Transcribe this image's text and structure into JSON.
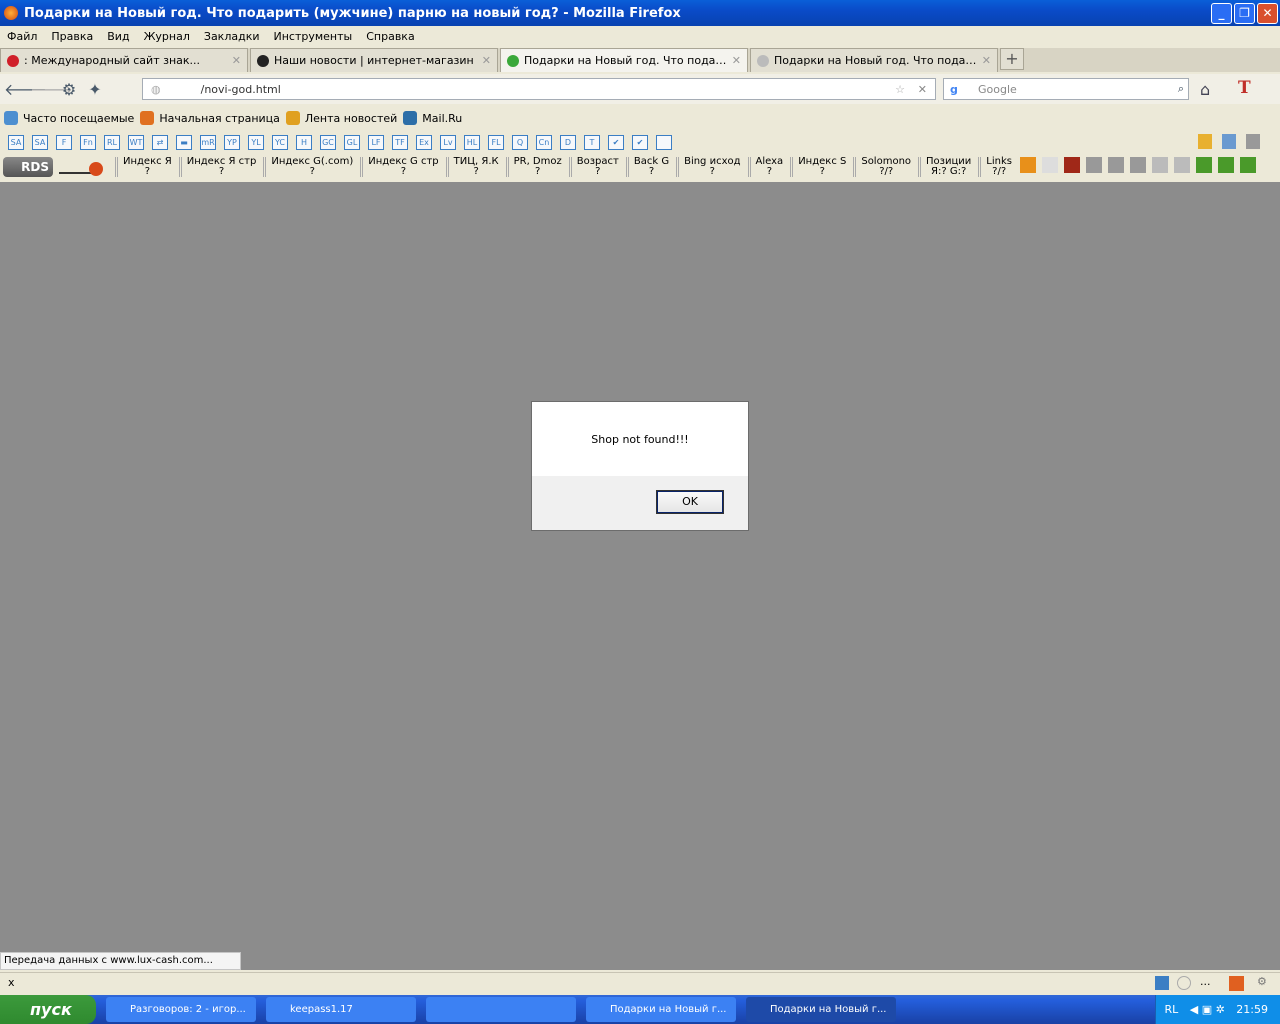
{
  "window": {
    "title": "Подарки на Новый год. Что подарить (мужчине) парню на новый год? - Mozilla Firefox"
  },
  "menu": [
    "Файл",
    "Правка",
    "Вид",
    "Журнал",
    "Закладки",
    "Инструменты",
    "Справка"
  ],
  "tabs": [
    {
      "label": ": Международный сайт знак...",
      "color": "#d0202a",
      "active": false
    },
    {
      "label": "Наши новости | интернет-магазин",
      "color": "#222",
      "active": false
    },
    {
      "label": "Подарки на Новый год. Что подарить ...",
      "color": "#3aa83a",
      "active": true
    },
    {
      "label": "Подарки на Новый год. Что подарить ...",
      "color": "#bbb",
      "active": false
    }
  ],
  "new_tab": "+",
  "address": {
    "value": "/novi-god.html"
  },
  "search": {
    "placeholder": "Google"
  },
  "bookmarks": [
    {
      "label": "Часто посещаемые",
      "color": "#4d8fd0"
    },
    {
      "label": "Начальная страница",
      "color": "#e07020"
    },
    {
      "label": "Лента новостей",
      "color": "#e0a020"
    },
    {
      "label": "Mail.Ru",
      "color": "#2c6ea8"
    }
  ],
  "toolbar1": [
    "SA",
    "SA",
    "F",
    "Fn",
    "RL",
    "WT",
    "⇄",
    "▬",
    "mR",
    "YP",
    "YL",
    "YC",
    "H",
    "GC",
    "GL",
    "LF",
    "TF",
    "Ex",
    "Lv",
    "HL",
    "FL",
    "Q",
    "Cn",
    "D",
    "T",
    "✔",
    "✔",
    ""
  ],
  "toolbar2": {
    "rds": "RDS",
    "metrics": [
      {
        "label": "Индекс Я",
        "value": "?"
      },
      {
        "label": "Индекс Я стр",
        "value": "?"
      },
      {
        "label": "Индекс G(.com)",
        "value": "?"
      },
      {
        "label": "Индекс G стр",
        "value": "?"
      },
      {
        "label": "ТИЦ, Я.К",
        "value": "?"
      },
      {
        "label": "PR, Dmoz",
        "value": "?"
      },
      {
        "label": "Возраст",
        "value": "?"
      },
      {
        "label": "Back G",
        "value": "?"
      },
      {
        "label": "Bing исход",
        "value": "?"
      },
      {
        "label": "Alexa",
        "value": "?"
      },
      {
        "label": "Индекс S",
        "value": "?"
      },
      {
        "label": "Solomono",
        "value": "?/?"
      },
      {
        "label": "Позиции",
        "value": "Я:? G:?"
      },
      {
        "label": "Links",
        "value": "?/?"
      }
    ]
  },
  "dialog": {
    "message": "Shop not found!!!",
    "ok": "OK"
  },
  "status": "Передача данных с www.lux-cash.com...",
  "addonbar": {
    "close": "x",
    "dots": "..."
  },
  "taskbar": {
    "start": "пуск",
    "tasks": [
      {
        "label": "Разговоров: 2 - игор...",
        "active": false
      },
      {
        "label": "keepass1.17",
        "active": false
      },
      {
        "label": "",
        "active": false
      },
      {
        "label": "Подарки на Новый г...",
        "active": false
      },
      {
        "label": "Подарки на Новый г...",
        "active": true
      }
    ],
    "lang": "RL",
    "clock": "21:59"
  }
}
